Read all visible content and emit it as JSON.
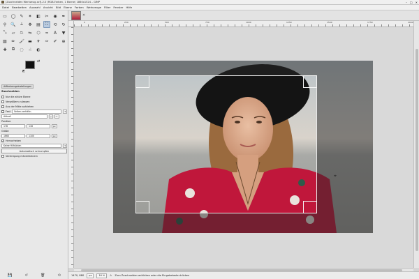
{
  "window": {
    "title": "[Zuschneiden Werkzeug.xcf]-2.0 (RGB-Farben, 1 Ebene) 1860x1524 – GIMP",
    "controls": [
      "–",
      "□",
      "✕"
    ]
  },
  "menubar": [
    "Datei",
    "Bearbeiten",
    "Auswahl",
    "Ansicht",
    "Bild",
    "Ebene",
    "Farben",
    "Werkzeuge",
    "Filter",
    "Fenster",
    "Hilfe"
  ],
  "tools": [
    {
      "icon": "rect-select-icon",
      "glyph": "▭"
    },
    {
      "icon": "ellipse-select-icon",
      "glyph": "◯"
    },
    {
      "icon": "free-select-icon",
      "glyph": "✎"
    },
    {
      "icon": "fuzzy-select-icon",
      "glyph": "✶"
    },
    {
      "icon": "color-select-icon",
      "glyph": "◧"
    },
    {
      "icon": "scissors-select-icon",
      "glyph": "✂"
    },
    {
      "icon": "foreground-select-icon",
      "glyph": "◉"
    },
    {
      "icon": "paths-icon",
      "glyph": "✒"
    },
    {
      "icon": "color-picker-icon",
      "glyph": "⚲"
    },
    {
      "icon": "zoom-icon",
      "glyph": "🔍"
    },
    {
      "icon": "measure-icon",
      "glyph": "⟂"
    },
    {
      "icon": "move-icon",
      "glyph": "✥"
    },
    {
      "icon": "align-icon",
      "glyph": "▤"
    },
    {
      "icon": "crop-icon",
      "glyph": "⛶"
    },
    {
      "icon": "unified-transform-icon",
      "glyph": "⟲"
    },
    {
      "icon": "rotate-icon",
      "glyph": "↻"
    },
    {
      "icon": "scale-icon",
      "glyph": "⤡"
    },
    {
      "icon": "shear-icon",
      "glyph": "▱"
    },
    {
      "icon": "perspective-icon",
      "glyph": "⏢"
    },
    {
      "icon": "flip-icon",
      "glyph": "⇋"
    },
    {
      "icon": "cage-icon",
      "glyph": "⬡"
    },
    {
      "icon": "warp-icon",
      "glyph": "≈"
    },
    {
      "icon": "text-icon",
      "glyph": "A"
    },
    {
      "icon": "bucket-fill-icon",
      "glyph": "▼"
    },
    {
      "icon": "blend-icon",
      "glyph": "▨"
    },
    {
      "icon": "pencil-icon",
      "glyph": "✏"
    },
    {
      "icon": "paintbrush-icon",
      "glyph": "🖌"
    },
    {
      "icon": "eraser-icon",
      "glyph": "▬"
    },
    {
      "icon": "airbrush-icon",
      "glyph": "✈"
    },
    {
      "icon": "ink-icon",
      "glyph": "✑"
    },
    {
      "icon": "mypaint-brush-icon",
      "glyph": "✐"
    },
    {
      "icon": "clone-icon",
      "glyph": "⊕"
    },
    {
      "icon": "heal-icon",
      "glyph": "✚"
    },
    {
      "icon": "perspective-clone-icon",
      "glyph": "⧉"
    },
    {
      "icon": "blur-icon",
      "glyph": "◌"
    },
    {
      "icon": "smudge-icon",
      "glyph": "☝"
    },
    {
      "icon": "dodge-burn-icon",
      "glyph": "◐"
    }
  ],
  "options": {
    "tab_label": "Werkzeugeinstellungen",
    "title": "Zuschneiden",
    "only_active_layer": "Nur die aktive Ebene",
    "delete_pixels": "Vergrößern zulassen",
    "from_center": "Aus der Mitte aufziehen",
    "fixed_label": "Fest",
    "fixed_value": "Seiten-verhältn.",
    "ratio_value": "Aktuell",
    "position_label": "Position:",
    "pos_x": "178",
    "pos_y": "116",
    "size_label": "Größe:",
    "size_w": "1660",
    "size_h": "1100",
    "unit": "px",
    "highlight": "Hervorheben",
    "guides": "Keine Hilfslinien",
    "auto_shrink": "Automatisch schrumpfen",
    "shrink_merged": "Vereinigung mitverkleinern"
  },
  "status": {
    "coords": "1470, 880",
    "unit": "px",
    "zoom": "16 %",
    "message": "Zum Zuschneiden anklicken oder die Eingabetaste drücken"
  },
  "ruler_labels": [
    "0",
    "250",
    "500",
    "750",
    "1000",
    "1250",
    "1500",
    "1750",
    "2000"
  ],
  "colors": {
    "accent": "#b9cbe0",
    "foreground": "#111111",
    "background": "#ffffff"
  }
}
